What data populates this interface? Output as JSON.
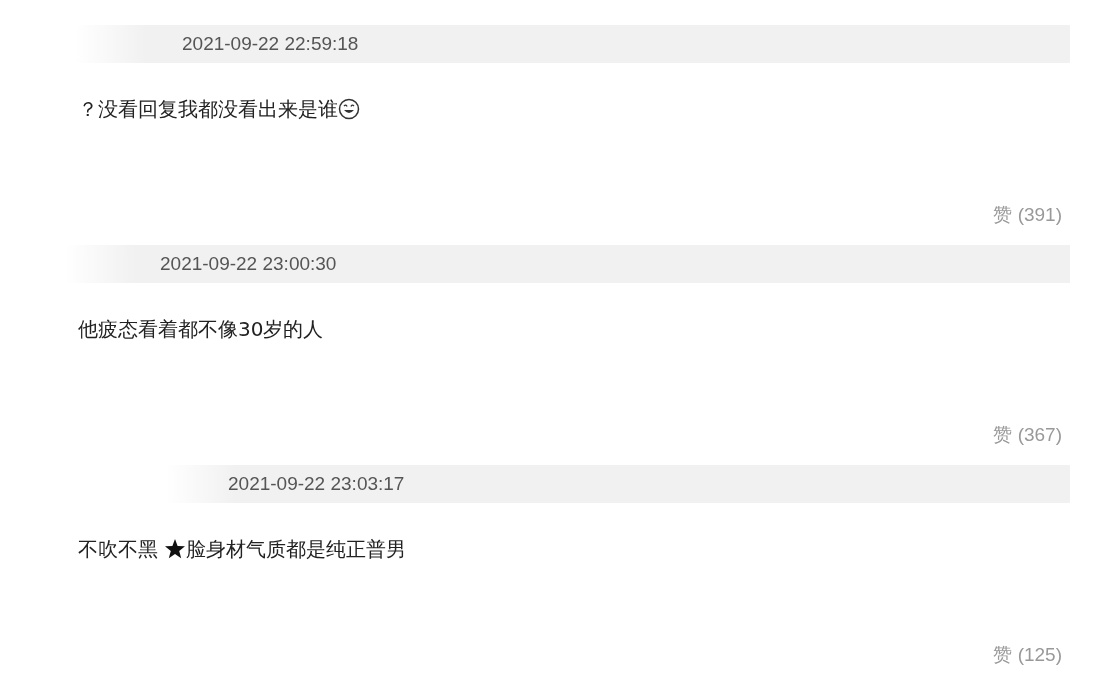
{
  "comments": [
    {
      "time": "2021-09-22 22:59:18",
      "parts": [
        {
          "kind": "text",
          "text": "？没看回复我都没看出来是谁"
        },
        {
          "kind": "smile"
        }
      ],
      "likes": "赞 (391)"
    },
    {
      "time": "2021-09-22 23:00:30",
      "parts": [
        {
          "kind": "text",
          "text": "他疲态看着都不像30岁的人"
        }
      ],
      "likes": "赞 (367)"
    },
    {
      "time": "2021-09-22 23:03:17",
      "parts": [
        {
          "kind": "text",
          "text": "不吹不黑 "
        },
        {
          "kind": "star"
        },
        {
          "kind": "text",
          "text": "脸身材气质都是纯正普男"
        }
      ],
      "likes": "赞 (125)"
    }
  ]
}
